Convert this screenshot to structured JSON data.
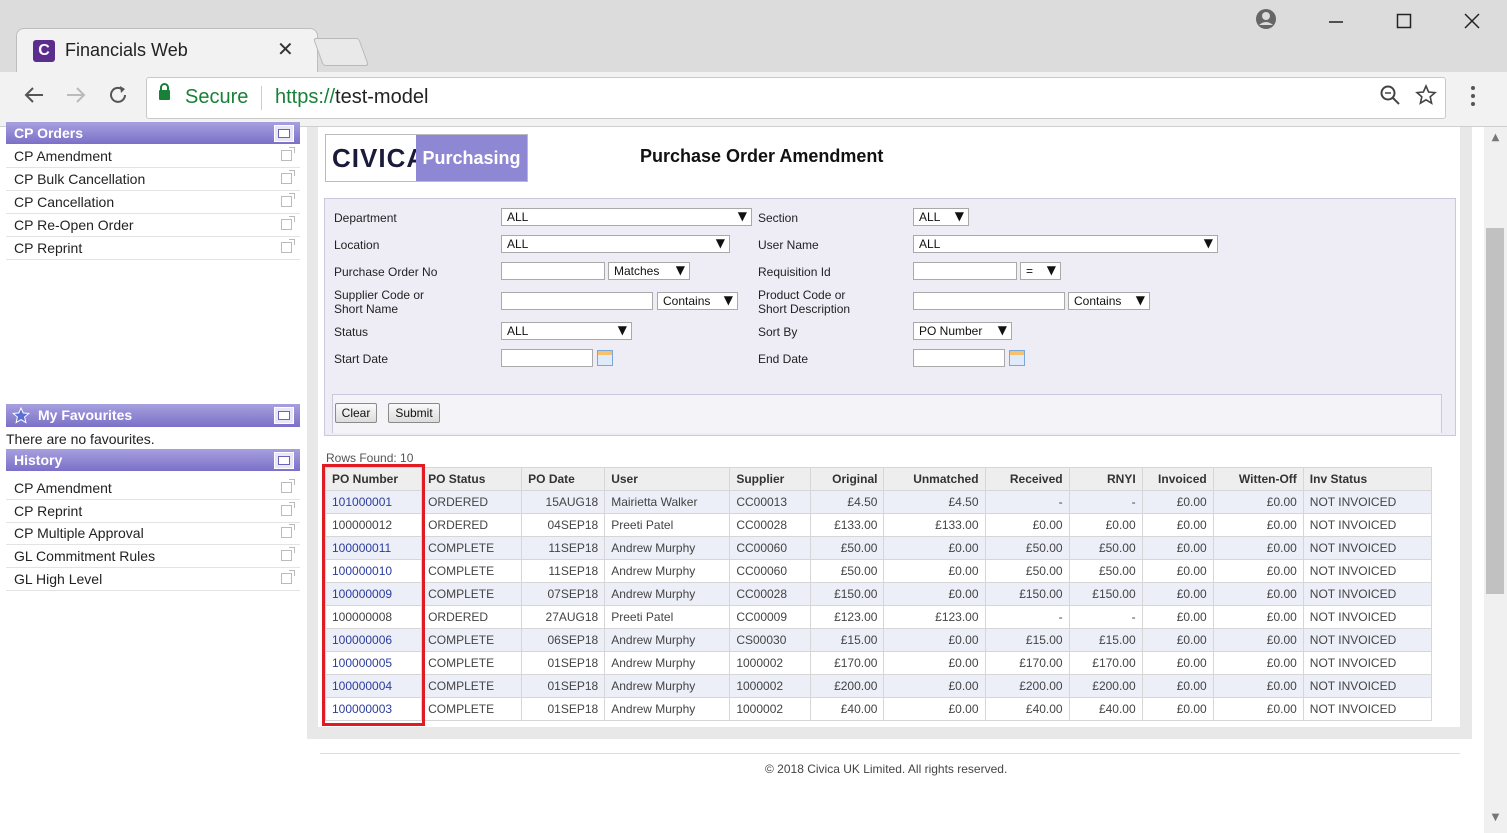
{
  "browser": {
    "tab_title": "Financials Web",
    "tab_favicon": "C",
    "tab_close": "✕",
    "security_label": "Secure",
    "url_scheme": "https://",
    "url_host": "test-model",
    "icons": [
      "profile-icon",
      "minimize-icon",
      "maximize-icon",
      "close-icon",
      "back-icon",
      "forward-icon",
      "reload-icon",
      "lock-icon",
      "zoom-icon",
      "bookmark-star-icon",
      "menu-icon"
    ]
  },
  "sidebar": {
    "cp_orders": {
      "title": "CP Orders",
      "items": [
        "CP Amendment",
        "CP Bulk Cancellation",
        "CP Cancellation",
        "CP Re-Open Order",
        "CP Reprint"
      ]
    },
    "favourites": {
      "title": "My Favourites",
      "empty_text": "There are no favourites."
    },
    "history": {
      "title": "History",
      "items": [
        "CP Amendment",
        "CP Reprint",
        "CP Multiple Approval",
        "GL Commitment Rules",
        "GL High Level"
      ]
    }
  },
  "logo": {
    "brand": "CIVICA",
    "product": "Purchasing"
  },
  "page_title": "Purchase Order Amendment",
  "form": {
    "department": {
      "label": "Department",
      "value": "ALL"
    },
    "section": {
      "label": "Section",
      "value": "ALL"
    },
    "location": {
      "label": "Location",
      "value": "ALL"
    },
    "user_name": {
      "label": "User Name",
      "value": "ALL"
    },
    "po_no": {
      "label": "Purchase Order No",
      "value": "",
      "mode": "Matches"
    },
    "requisition_id": {
      "label": "Requisition Id",
      "value": "",
      "mode": "="
    },
    "supplier": {
      "label_1": "Supplier Code or",
      "label_2": "Short Name",
      "value": "",
      "mode": "Contains"
    },
    "product": {
      "label_1": "Product Code or",
      "label_2": "Short Description",
      "value": "",
      "mode": "Contains"
    },
    "status": {
      "label": "Status",
      "value": "ALL"
    },
    "sort_by": {
      "label": "Sort By",
      "value": "PO Number"
    },
    "start_date": {
      "label": "Start Date",
      "value": ""
    },
    "end_date": {
      "label": "End Date",
      "value": ""
    },
    "clear_label": "Clear",
    "submit_label": "Submit"
  },
  "results": {
    "rows_found": "Rows Found: 10",
    "columns": [
      "PO Number",
      "PO Status",
      "PO Date",
      "User",
      "Supplier",
      "Original",
      "Unmatched",
      "Received",
      "RNYI",
      "Invoiced",
      "Witten-Off",
      "Inv Status"
    ],
    "rows": [
      [
        "101000001",
        "ORDERED",
        "15AUG18",
        "Mairietta Walker",
        "CC00013",
        "£4.50",
        "£4.50",
        "-",
        "-",
        "£0.00",
        "£0.00",
        "NOT INVOICED"
      ],
      [
        "100000012",
        "ORDERED",
        "04SEP18",
        "Preeti Patel",
        "CC00028",
        "£133.00",
        "£133.00",
        "£0.00",
        "£0.00",
        "£0.00",
        "£0.00",
        "NOT INVOICED"
      ],
      [
        "100000011",
        "COMPLETE",
        "11SEP18",
        "Andrew Murphy",
        "CC00060",
        "£50.00",
        "£0.00",
        "£50.00",
        "£50.00",
        "£0.00",
        "£0.00",
        "NOT INVOICED"
      ],
      [
        "100000010",
        "COMPLETE",
        "11SEP18",
        "Andrew Murphy",
        "CC00060",
        "£50.00",
        "£0.00",
        "£50.00",
        "£50.00",
        "£0.00",
        "£0.00",
        "NOT INVOICED"
      ],
      [
        "100000009",
        "COMPLETE",
        "07SEP18",
        "Andrew Murphy",
        "CC00028",
        "£150.00",
        "£0.00",
        "£150.00",
        "£150.00",
        "£0.00",
        "£0.00",
        "NOT INVOICED"
      ],
      [
        "100000008",
        "ORDERED",
        "27AUG18",
        "Preeti Patel",
        "CC00009",
        "£123.00",
        "£123.00",
        "-",
        "-",
        "£0.00",
        "£0.00",
        "NOT INVOICED"
      ],
      [
        "100000006",
        "COMPLETE",
        "06SEP18",
        "Andrew Murphy",
        "CS00030",
        "£15.00",
        "£0.00",
        "£15.00",
        "£15.00",
        "£0.00",
        "£0.00",
        "NOT INVOICED"
      ],
      [
        "100000005",
        "COMPLETE",
        "01SEP18",
        "Andrew Murphy",
        "1000002",
        "£170.00",
        "£0.00",
        "£170.00",
        "£170.00",
        "£0.00",
        "£0.00",
        "NOT INVOICED"
      ],
      [
        "100000004",
        "COMPLETE",
        "01SEP18",
        "Andrew Murphy",
        "1000002",
        "£200.00",
        "£0.00",
        "£200.00",
        "£200.00",
        "£0.00",
        "£0.00",
        "NOT INVOICED"
      ],
      [
        "100000003",
        "COMPLETE",
        "01SEP18",
        "Andrew Murphy",
        "1000002",
        "£40.00",
        "£0.00",
        "£40.00",
        "£40.00",
        "£0.00",
        "£0.00",
        "NOT INVOICED"
      ]
    ],
    "linked_rows": [
      0,
      2,
      3,
      4,
      6,
      7,
      8,
      9
    ]
  },
  "footer": "© 2018 Civica UK Limited. All rights reserved.",
  "colors": {
    "accent": "#7b70c8",
    "link": "#2b3d9c",
    "highlight": "#e01b24",
    "secure": "#188038"
  }
}
